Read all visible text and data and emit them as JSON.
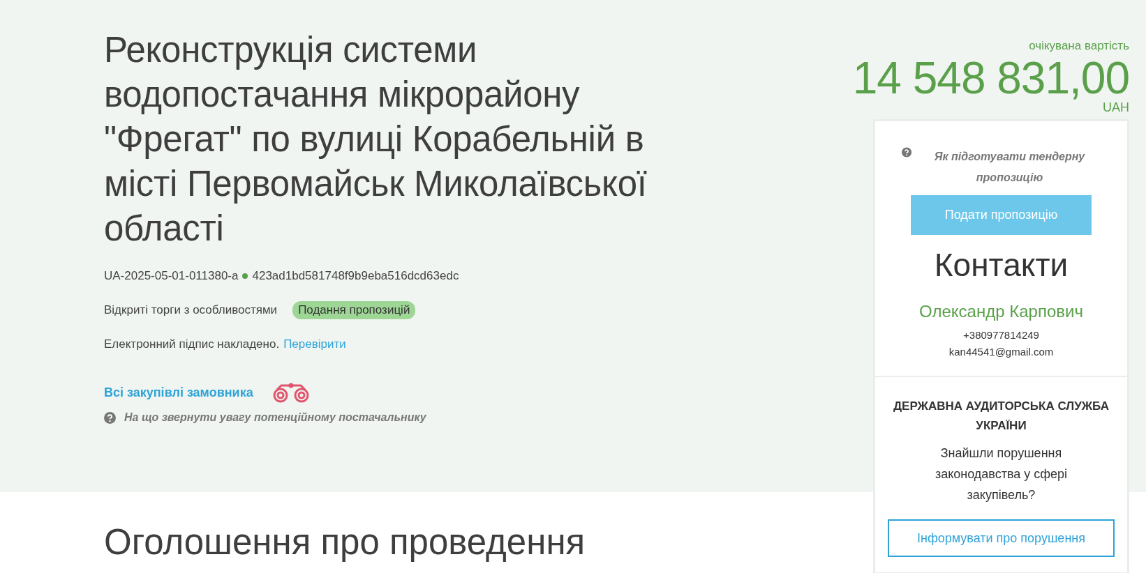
{
  "title": "Реконструкція системи водопостачання мікрорайону \"Фрегат\" по вулиці Корабельній в місті Первомайськ Миколаївської області",
  "tender_id": "UA-2025-05-01-011380-a",
  "hash": "423ad1bd581748f9b9eba516dcd63edc",
  "procedure": "Відкриті торги з особливостями",
  "status": "Подання пропозицій",
  "signature": {
    "text": "Електронний підпис накладено.",
    "link": "Перевірити"
  },
  "buyer_link": "Всі закупівлі замовника",
  "hint": "На що звернути увагу потенційному постачальнику",
  "price": {
    "label": "очікувана вартість",
    "amount": "14 548 831,00",
    "currency": "UAH"
  },
  "panel": {
    "help": "Як підготувати тендерну пропозицію",
    "submit": "Подати пропозицію",
    "contacts_title": "Контакти",
    "contact_name": "Олександр Карпович",
    "phone": "+380977814249",
    "email": "kan44541@gmail.com"
  },
  "audit": {
    "title": "ДЕРЖАВНА АУДИТОРСЬКА СЛУЖБА УКРАЇНИ",
    "question": "Знайшли порушення законодавства у сфері закупівель?",
    "button": "Інформувати про порушення"
  },
  "section_heading": "Оголошення про проведення"
}
